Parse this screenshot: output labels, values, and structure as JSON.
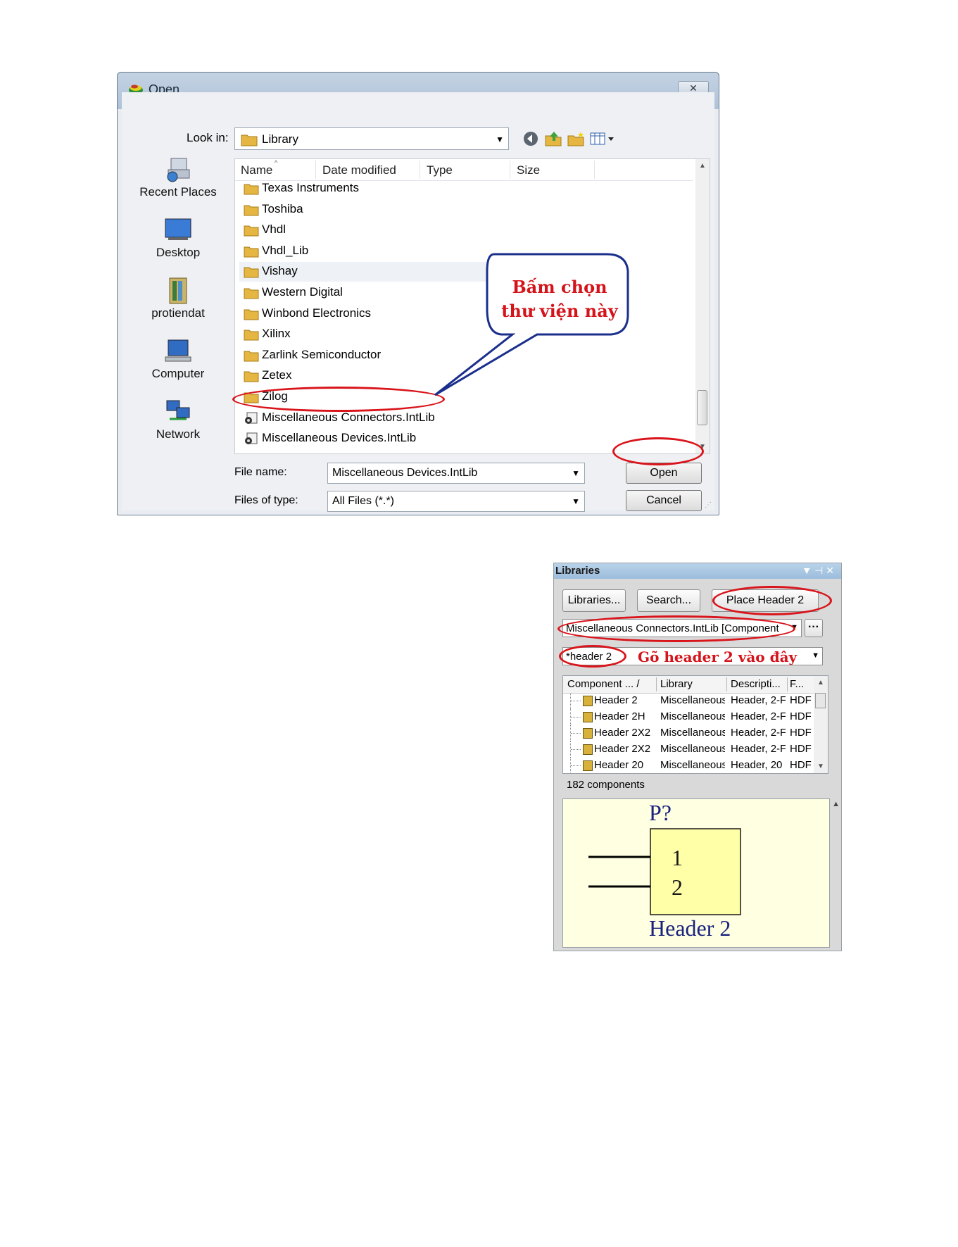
{
  "open_dialog": {
    "title": "Open",
    "look_in_label": "Look in:",
    "look_in_value": "Library",
    "places": [
      "Recent Places",
      "Desktop",
      "protiendat",
      "Computer",
      "Network"
    ],
    "columns": [
      "Name",
      "Date modified",
      "Type",
      "Size"
    ],
    "files": [
      {
        "name": "Texas Instruments",
        "kind": "folder"
      },
      {
        "name": "Toshiba",
        "kind": "folder"
      },
      {
        "name": "Vhdl",
        "kind": "folder"
      },
      {
        "name": "Vhdl_Lib",
        "kind": "folder"
      },
      {
        "name": "Vishay",
        "kind": "folder"
      },
      {
        "name": "Western Digital",
        "kind": "folder"
      },
      {
        "name": "Winbond Electronics",
        "kind": "folder"
      },
      {
        "name": "Xilinx",
        "kind": "folder"
      },
      {
        "name": "Zarlink Semiconductor",
        "kind": "folder"
      },
      {
        "name": "Zetex",
        "kind": "folder"
      },
      {
        "name": "Zilog",
        "kind": "folder"
      },
      {
        "name": "Miscellaneous Connectors.IntLib",
        "kind": "intlib"
      },
      {
        "name": "Miscellaneous Devices.IntLib",
        "kind": "intlib"
      }
    ],
    "file_name_label": "File name:",
    "file_name_value": "Miscellaneous Devices.IntLib",
    "files_of_type_label": "Files of type:",
    "files_of_type_value": "All Files (*.*)",
    "open_label": "Open",
    "cancel_label": "Cancel",
    "callout_line1": "Bấm chọn",
    "callout_line2": "thư viện này"
  },
  "libraries_panel": {
    "title": "Libraries",
    "btn_libraries": "Libraries...",
    "btn_search": "Search...",
    "btn_place": "Place Header 2",
    "library_select": "Miscellaneous Connectors.IntLib [Component",
    "filter_value": "*header 2",
    "filter_annotation": "Gõ header 2 vào đây",
    "grid_columns": [
      "Component ... /",
      "Library",
      "Descripti...",
      "F..."
    ],
    "grid_rows": [
      [
        "Header 2",
        "Miscellaneous",
        "Header, 2-F",
        "HDF"
      ],
      [
        "Header 2H",
        "Miscellaneous",
        "Header, 2-F",
        "HDF"
      ],
      [
        "Header 2X2",
        "Miscellaneous",
        "Header, 2-F",
        "HDF"
      ],
      [
        "Header 2X2",
        "Miscellaneous",
        "Header, 2-F",
        "HDF"
      ],
      [
        "Header 20",
        "Miscellaneous",
        "Header, 20",
        "HDF"
      ]
    ],
    "component_count": "182 components",
    "preview": {
      "designator": "P?",
      "pin1": "1",
      "pin2": "2",
      "comment": "Header 2"
    }
  },
  "colors": {
    "annotation_red": "#d4131a",
    "callout_border": "#1a2f8c",
    "preview_bg": "#ffffe2",
    "symbol_fill": "#ffffa8",
    "symbol_text": "#1a237e"
  }
}
